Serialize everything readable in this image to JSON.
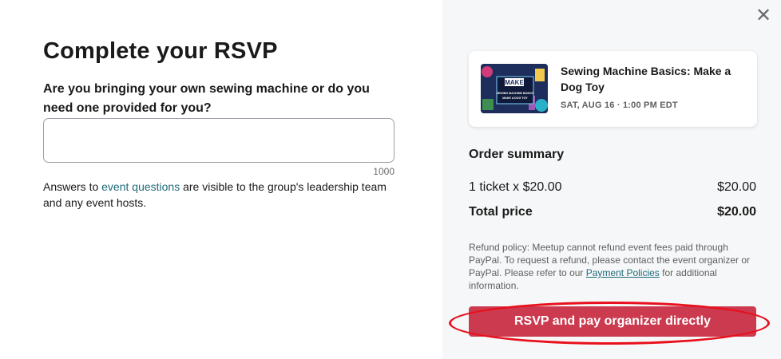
{
  "form": {
    "title": "Complete your RSVP",
    "question": "Are you bringing your own sewing machine or do you need one provided for you?",
    "answer_value": "",
    "char_limit": "1000",
    "note_prefix": "Answers to ",
    "note_link": "event questions",
    "note_suffix": " are visible to the group's leadership team and any event hosts."
  },
  "close_icon": "close-icon",
  "event": {
    "title": "Sewing Machine Basics: Make a Dog Toy",
    "date": "SAT, AUG 16 · 1:00 PM EDT",
    "thumb_text_1": "MAKE",
    "thumb_text_2": "SEWING MACHINE BASICS",
    "thumb_text_3": "MAKE A DOG TOY"
  },
  "order": {
    "heading": "Order summary",
    "ticket_label": "1 ticket x $20.00",
    "ticket_price": "$20.00",
    "total_label": "Total price",
    "total_price": "$20.00"
  },
  "policy": {
    "text_before": "Refund policy: Meetup cannot refund event fees paid through PayPal. To request a refund, please contact the event organizer or PayPal. Please refer to our ",
    "link": "Payment Policies",
    "text_after": " for additional information."
  },
  "cta": {
    "label": "RSVP and pay organizer directly"
  },
  "colors": {
    "cta": "#cc3a4f",
    "link": "#1f6b79",
    "highlight": "#e8101c"
  }
}
